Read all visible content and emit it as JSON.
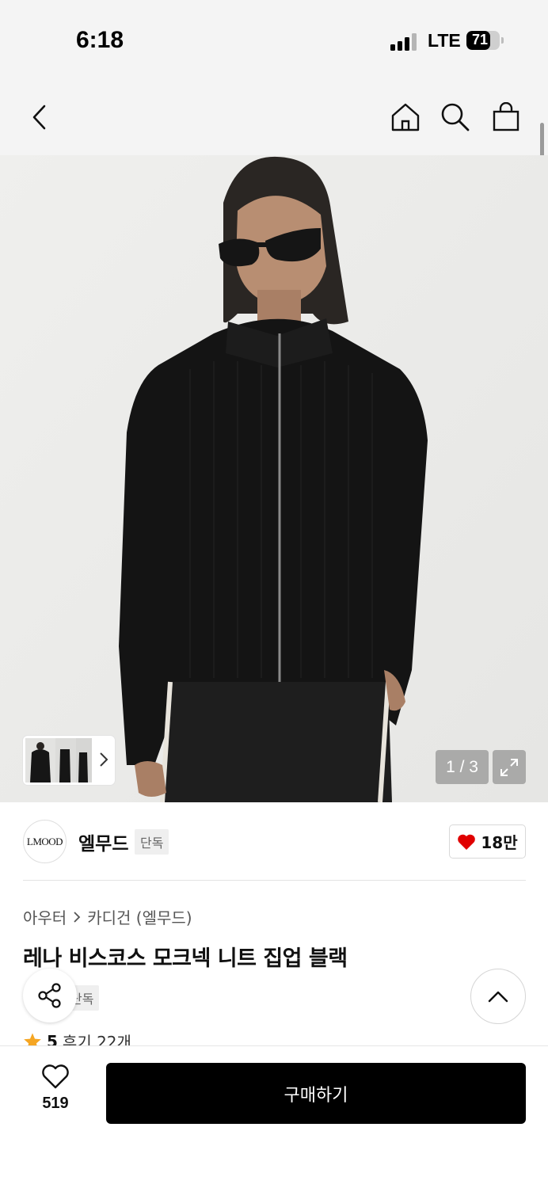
{
  "status_bar": {
    "time": "6:18",
    "network": "LTE",
    "battery": "71",
    "battery_level": 0.71
  },
  "nav": {
    "icons": [
      "back-icon",
      "home-icon",
      "search-icon",
      "bag-icon"
    ]
  },
  "gallery": {
    "counter": "1 / 3",
    "icons": [
      "chevron-right-icon",
      "expand-icon"
    ]
  },
  "brand": {
    "logo_text": "LMOOD",
    "name": "엘무드",
    "badge": "단독",
    "likes": "18만",
    "heart_color": "#e00000"
  },
  "breadcrumb": {
    "items": [
      "아우터",
      "카디건 (엘무드)"
    ]
  },
  "product": {
    "title": "레나 비스코스 모크넥 니트 집업 블랙",
    "badge": "단독"
  },
  "rating": {
    "score": "5",
    "reviews": "후기 22개",
    "star_color": "#f5a623"
  },
  "bottom": {
    "wish_count": "519",
    "buy_label": "구매하기"
  }
}
